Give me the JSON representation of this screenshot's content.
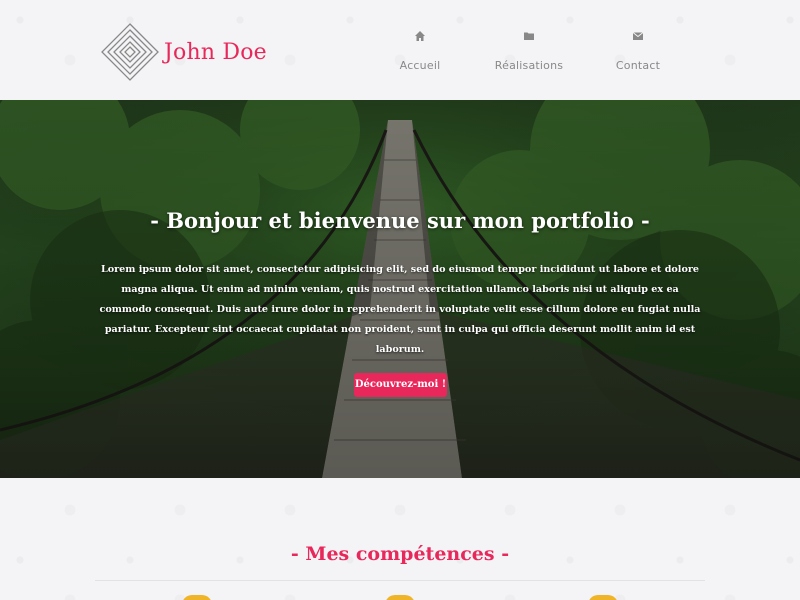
{
  "header": {
    "brand": "John Doe",
    "nav": [
      {
        "label": "Accueil",
        "icon": "home-icon"
      },
      {
        "label": "Réalisations",
        "icon": "folder-icon"
      },
      {
        "label": "Contact",
        "icon": "envelope-icon"
      }
    ]
  },
  "hero": {
    "title": "- Bonjour et bienvenue sur mon portfolio -",
    "text": "Lorem ipsum dolor sit amet, consectetur adipisicing elit, sed do eiusmod tempor incididunt ut labore et dolore magna aliqua. Ut enim ad minim veniam, quis nostrud exercitation ullamco laboris nisi ut aliquip ex ea commodo consequat. Duis aute irure dolor in reprehenderit in voluptate velit esse cillum dolore eu fugiat nulla pariatur. Excepteur sint occaecat cupidatat non proident, sunt in culpa qui officia deserunt mollit anim id est laborum.",
    "cta": "Découvrez-moi !"
  },
  "skills": {
    "title": "- Mes compétences -"
  },
  "colors": {
    "accent": "#e8285a",
    "nav_text": "#888888",
    "background": "#f4f4f6"
  }
}
